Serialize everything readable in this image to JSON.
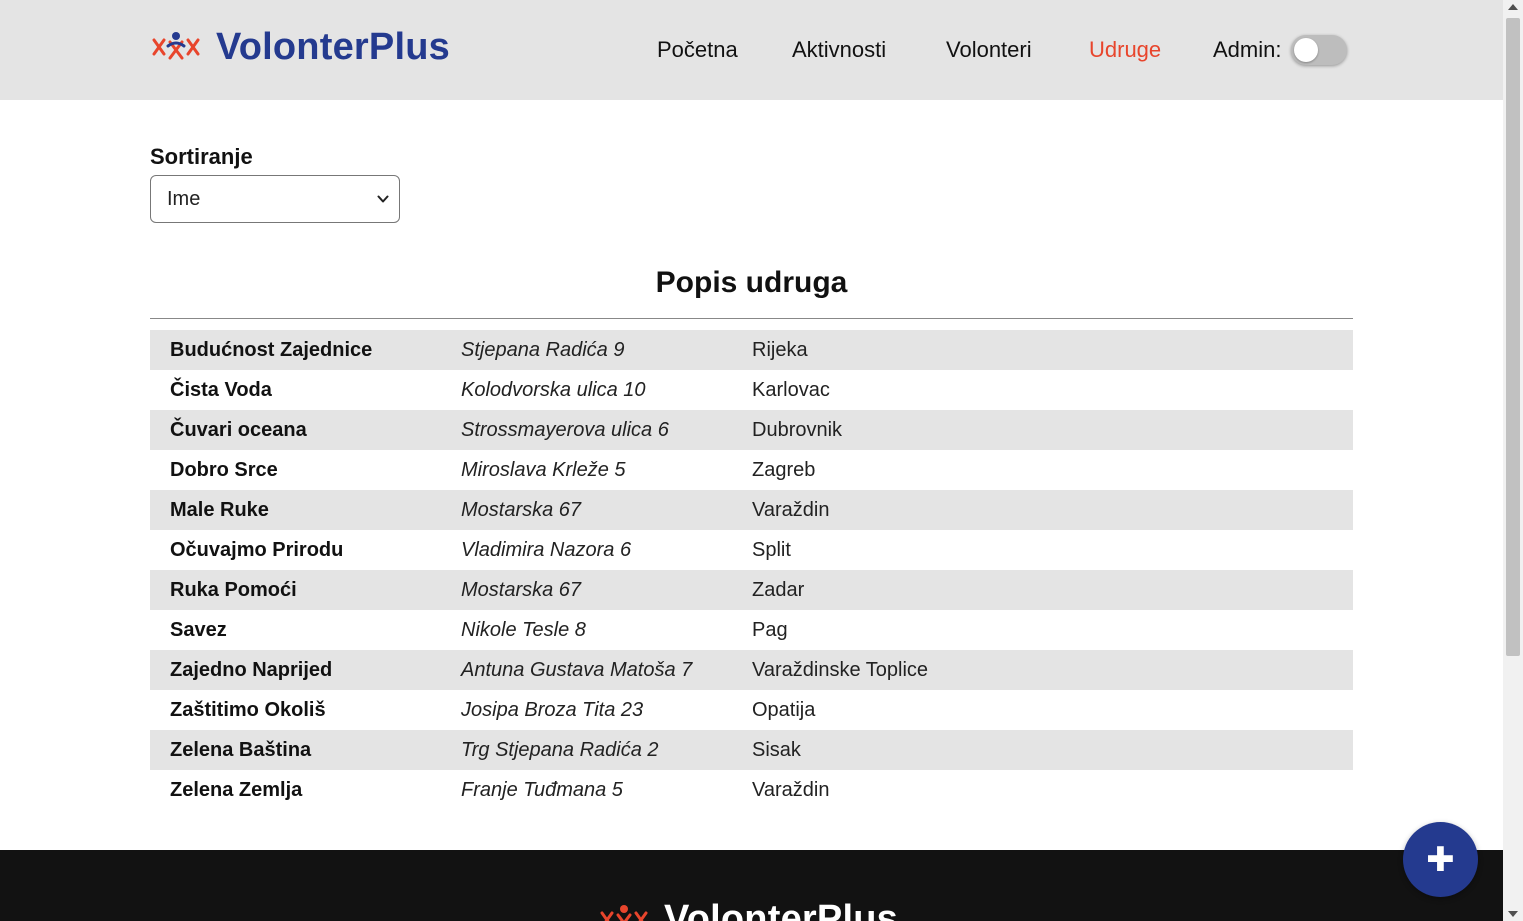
{
  "header": {
    "brand": "VolonterPlus",
    "nav": [
      {
        "label": "Početna",
        "active": false
      },
      {
        "label": "Aktivnosti",
        "active": false
      },
      {
        "label": "Volonteri",
        "active": false
      },
      {
        "label": "Udruge",
        "active": true
      }
    ],
    "admin_label": "Admin:",
    "admin_enabled": false
  },
  "sort": {
    "label": "Sortiranje",
    "selected": "Ime"
  },
  "list": {
    "title": "Popis udruga",
    "rows": [
      {
        "name": "Budućnost Zajednice",
        "address": "Stjepana Radića 9",
        "city": "Rijeka"
      },
      {
        "name": "Čista Voda",
        "address": "Kolodvorska ulica 10",
        "city": "Karlovac"
      },
      {
        "name": "Čuvari oceana",
        "address": "Strossmayerova ulica 6",
        "city": "Dubrovnik"
      },
      {
        "name": "Dobro Srce",
        "address": "Miroslava Krleže 5",
        "city": "Zagreb"
      },
      {
        "name": "Male Ruke",
        "address": "Mostarska 67",
        "city": "Varaždin"
      },
      {
        "name": "Očuvajmo Prirodu",
        "address": "Vladimira Nazora 6",
        "city": "Split"
      },
      {
        "name": "Ruka Pomoći",
        "address": "Mostarska 67",
        "city": "Zadar"
      },
      {
        "name": "Savez",
        "address": "Nikole Tesle 8",
        "city": "Pag"
      },
      {
        "name": "Zajedno Naprijed",
        "address": "Antuna Gustava Matoša 7",
        "city": "Varaždinske Toplice"
      },
      {
        "name": "Zaštitimo Okoliš",
        "address": "Josipa Broza Tita 23",
        "city": "Opatija"
      },
      {
        "name": "Zelena Baština",
        "address": "Trg Stjepana Radića 2",
        "city": "Sisak"
      },
      {
        "name": "Zelena Zemlja",
        "address": "Franje Tuđmana 5",
        "city": "Varaždin"
      }
    ]
  },
  "footer": {
    "brand": "VolonterPlus"
  },
  "fab": {
    "icon": "plus-icon",
    "glyph": "✚"
  },
  "colors": {
    "brand_blue": "#243a8f",
    "accent_red": "#e8452c",
    "header_bg": "#e4e4e4",
    "footer_bg": "#121212"
  }
}
